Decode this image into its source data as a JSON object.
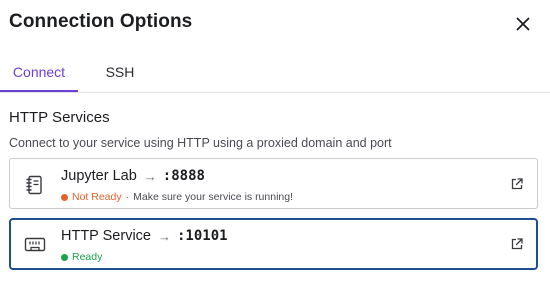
{
  "dialog": {
    "title": "Connection Options",
    "close_icon": "close-icon"
  },
  "tabs": [
    {
      "label": "Connect",
      "active": true
    },
    {
      "label": "SSH",
      "active": false
    }
  ],
  "section": {
    "title": "HTTP Services",
    "description": "Connect to your service using HTTP using a proxied domain and port"
  },
  "services": [
    {
      "name": "Jupyter Lab",
      "arrow": "→",
      "port": ":8888",
      "status": "Not Ready",
      "status_color": "#e2632b",
      "separator": "·",
      "hint": "Make sure your service is running!",
      "icon": "notebook-icon",
      "link_icon": "external-link-icon",
      "selected": false
    },
    {
      "name": "HTTP Service",
      "arrow": "→",
      "port": ":10101",
      "status": "Ready",
      "status_color": "#1aa34a",
      "icon": "ethernet-port-icon",
      "link_icon": "external-link-icon",
      "selected": true
    }
  ],
  "colors": {
    "accent": "#6b3fd1",
    "selected_border": "#1d4f91"
  }
}
